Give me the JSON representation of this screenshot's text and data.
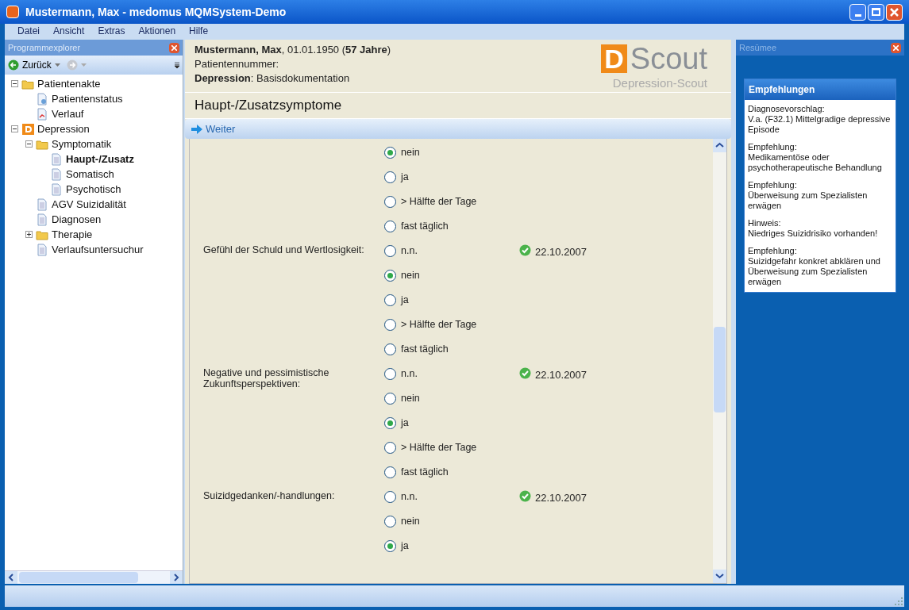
{
  "window": {
    "title": "Mustermann, Max - medomus MQMSystem-Demo"
  },
  "menu": [
    "Datei",
    "Ansicht",
    "Extras",
    "Aktionen",
    "Hilfe"
  ],
  "explorer": {
    "title": "Programmexplorer",
    "back": "Zurück",
    "tree": [
      {
        "label": "Patientenakte",
        "kind": "folder",
        "expanded": true,
        "selected": false,
        "children": [
          {
            "label": "Patientenstatus",
            "kind": "status",
            "selected": false
          },
          {
            "label": "Verlauf",
            "kind": "chart",
            "selected": false
          }
        ]
      },
      {
        "label": "Depression",
        "kind": "module",
        "expanded": true,
        "selected": false,
        "children": [
          {
            "label": "Symptomatik",
            "kind": "folder",
            "expanded": true,
            "selected": false,
            "children": [
              {
                "label": "Haupt-/Zusatz",
                "kind": "page",
                "selected": true
              },
              {
                "label": "Somatisch",
                "kind": "page",
                "selected": false
              },
              {
                "label": "Psychotisch",
                "kind": "page",
                "selected": false
              }
            ]
          },
          {
            "label": "AGV Suizidalität",
            "kind": "page",
            "selected": false
          },
          {
            "label": "Diagnosen",
            "kind": "page",
            "selected": false
          },
          {
            "label": "Therapie",
            "kind": "folder",
            "expanded": false,
            "selected": false
          },
          {
            "label": "Verlaufsuntersuchur",
            "kind": "page",
            "selected": false
          }
        ]
      }
    ]
  },
  "patient": {
    "line1": "**Mustermann, Max**, 01.01.1950 (**57 Jahre**)",
    "line2": "Patientennummer:",
    "line3": "**Depression**: Basisdokumentation",
    "logo_letter": "D",
    "logo_word": "Scout",
    "logo_caption": "Depression-Scout"
  },
  "section_title": "Haupt-/Zusatzsymptome",
  "next_button": "Weiter",
  "form": [
    {
      "options": [
        {
          "label": "nein",
          "selected": true
        },
        {
          "label": "ja",
          "selected": false
        },
        {
          "label": "> Hälfte der Tage",
          "selected": false
        },
        {
          "label": "fast täglich",
          "selected": false
        }
      ]
    },
    {
      "label": "Gefühl der Schuld und Wertlosigkeit:",
      "date": "22.10.2007",
      "options": [
        {
          "label": "n.n.",
          "selected": false
        },
        {
          "label": "nein",
          "selected": true
        },
        {
          "label": "ja",
          "selected": false
        },
        {
          "label": "> Hälfte der Tage",
          "selected": false
        },
        {
          "label": "fast täglich",
          "selected": false
        }
      ]
    },
    {
      "label": "Negative und pessimistische Zukunftsperspektiven:",
      "date": "22.10.2007",
      "options": [
        {
          "label": "n.n.",
          "selected": false
        },
        {
          "label": "nein",
          "selected": false
        },
        {
          "label": "ja",
          "selected": true
        },
        {
          "label": "> Hälfte der Tage",
          "selected": false
        },
        {
          "label": "fast täglich",
          "selected": false
        }
      ]
    },
    {
      "label": "Suizidgedanken/-handlungen:",
      "date": "22.10.2007",
      "options": [
        {
          "label": "n.n.",
          "selected": false
        },
        {
          "label": "nein",
          "selected": false
        },
        {
          "label": "ja",
          "selected": true
        }
      ]
    }
  ],
  "summary": {
    "title": "Resümee",
    "heading": "Empfehlungen",
    "items": [
      {
        "title": "Diagnosevorschlag:",
        "text": "V.a. (F32.1) Mittelgradige depressive Episode"
      },
      {
        "title": "Empfehlung:",
        "text": "Medikamentöse oder psychotherapeutische Behandlung"
      },
      {
        "title": "Empfehlung:",
        "text": "Überweisung zum Spezialisten erwägen"
      },
      {
        "title": "Hinweis:",
        "text": "Niedriges Suizidrisiko vorhanden!"
      },
      {
        "title": "Empfehlung:",
        "text": "Suizidgefahr konkret abklären und Überweisung zum Spezialisten erwägen"
      }
    ]
  }
}
